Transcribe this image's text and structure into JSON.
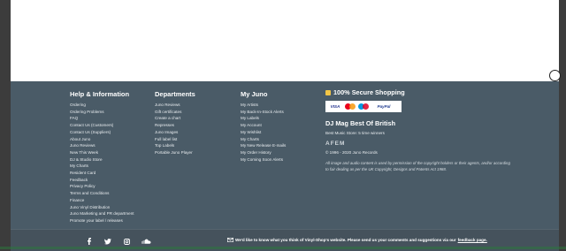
{
  "help": {
    "title": "Help & Information",
    "items": [
      "Ordering",
      "Ordering Problems",
      "FAQ",
      "Contact Us (Customers)",
      "Contact Us (Suppliers)",
      "About Juno",
      "Juno Reviews",
      "New This Week",
      "DJ & Studio Store",
      "My Charts",
      "Resident Card",
      "Feedback",
      "Privacy Policy",
      "Terms and Conditions",
      "Finance",
      "Juno Vinyl Distribution",
      "Juno Marketing and PR department",
      "Promote your label / releases"
    ]
  },
  "departments": {
    "title": "Departments",
    "items": [
      "Juno Reviews",
      "Gift certificates",
      "Create a chart",
      "Represses",
      "Juno Images",
      "Full label list",
      "Top Labels",
      "Portable Juno Player"
    ]
  },
  "my_juno": {
    "title": "My Juno",
    "items": [
      "My Artists",
      "My Back-In-Stock Alerts",
      "My Labels",
      "My Account",
      "My Wishlist",
      "My Charts",
      "My New Release E-mails",
      "My Order History",
      "My Coming Soon Alerts"
    ]
  },
  "secure": {
    "title": "100% Secure Shopping",
    "cards": [
      "VISA",
      "PayPal"
    ]
  },
  "djmag": {
    "title": "DJ Mag Best Of British",
    "subtitle": "Best Music Store: 5 time winners"
  },
  "afem": "AFEM",
  "copyright": "© 1996 - 2020 Juno Records",
  "legal": "All image and audio content is used by permission of the copyright holders or their agents, and/or according to fair dealing as per the UK Copyright, Designs and Patents Act 1988.",
  "social": [
    "facebook-icon",
    "twitter-icon",
    "instagram-icon",
    "soundcloud-icon"
  ],
  "feedback": {
    "text": "We'd like to know what you think of Vinyl-Shop's website. Please send us your comments and suggestions via our",
    "link": "feedback page."
  },
  "colors": {
    "footer_bg": "#4a5b67",
    "accent_yellow": "#f3c646"
  }
}
